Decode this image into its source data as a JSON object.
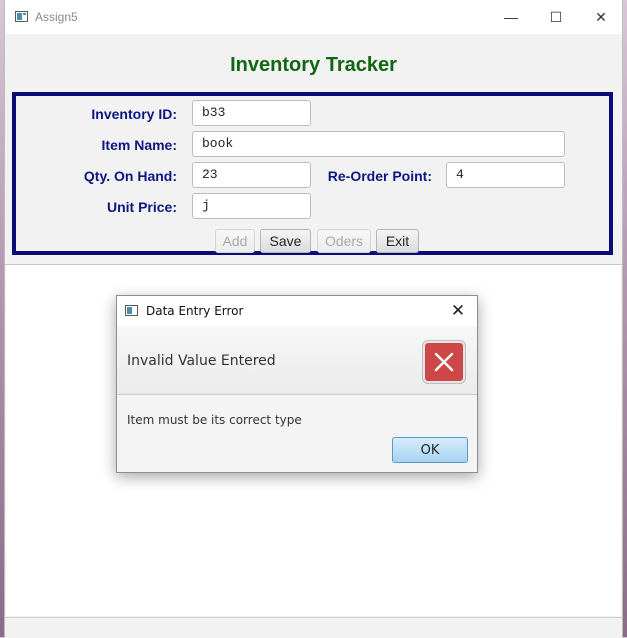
{
  "window": {
    "title": "Assign5",
    "controls": {
      "minimize": "—",
      "maximize": "☐",
      "close": "✕"
    }
  },
  "heading": "Inventory Tracker",
  "form": {
    "inventory_id": {
      "label": "Inventory ID:",
      "value": "b33"
    },
    "item_name": {
      "label": "Item Name:",
      "value": "book"
    },
    "qty_on_hand": {
      "label": "Qty. On Hand:",
      "value": "23"
    },
    "reorder_point": {
      "label": "Re-Order Point:",
      "value": "4"
    },
    "unit_price": {
      "label": "Unit Price:",
      "value": "j"
    }
  },
  "buttons": {
    "add": {
      "label": "Add",
      "enabled": false
    },
    "save": {
      "label": "Save",
      "enabled": true
    },
    "orders": {
      "label": "Oders",
      "enabled": false
    },
    "exit": {
      "label": "Exit",
      "enabled": true
    }
  },
  "dialog": {
    "title": "Data Entry Error",
    "header": "Invalid Value Entered",
    "content": "Item must be its correct type",
    "ok_label": "OK",
    "close_glyph": "✕",
    "icon": "error-x-icon",
    "icon_color": "#ce4747"
  },
  "colors": {
    "heading": "#116611",
    "labels": "#0d1780",
    "form_border": "#0a0a78"
  }
}
